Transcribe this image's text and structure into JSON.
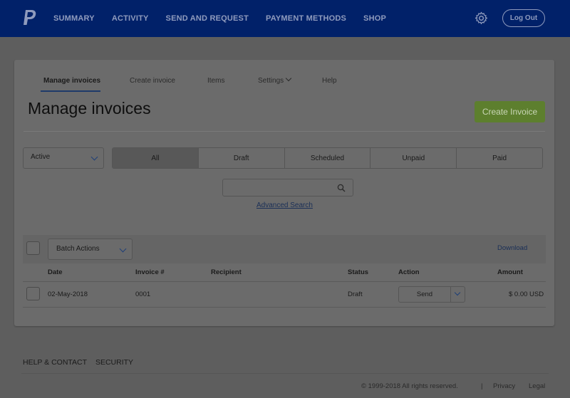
{
  "topnav": {
    "items": [
      "SUMMARY",
      "ACTIVITY",
      "SEND AND REQUEST",
      "PAYMENT METHODS",
      "SHOP"
    ],
    "logout_label": "Log Out",
    "logo_icon": "paypal-logo-icon",
    "settings_icon": "gear-icon",
    "bg_color": "#012169"
  },
  "subnav": {
    "tabs": [
      "Manage invoices",
      "Create invoice",
      "Items",
      "Settings",
      "Help"
    ],
    "active": "Manage invoices"
  },
  "page": {
    "title": "Manage invoices",
    "create_button": "Create Invoice",
    "create_button_color": "#5d7f2e"
  },
  "filters": {
    "status_selected": "Active",
    "segments": [
      "All",
      "Draft",
      "Scheduled",
      "Unpaid",
      "Paid"
    ],
    "active_segment": "All",
    "search_value": "",
    "advanced_search": "Advanced Search"
  },
  "table": {
    "batch_actions": "Batch Actions",
    "download": "Download",
    "headers": {
      "date": "Date",
      "invoice": "Invoice #",
      "recipient": "Recipient",
      "status": "Status",
      "action": "Action",
      "amount": "Amount"
    },
    "rows": [
      {
        "date": "02-May-2018",
        "invoice": "0001",
        "recipient": "",
        "status": "Draft",
        "action": "Send",
        "amount": "$ 0.00 USD"
      }
    ]
  },
  "footer": {
    "links": [
      "HELP & CONTACT",
      "SECURITY"
    ],
    "copyright": "© 1999-2018 All rights reserved.",
    "separator": "|",
    "privacy": "Privacy",
    "legal": "Legal"
  }
}
